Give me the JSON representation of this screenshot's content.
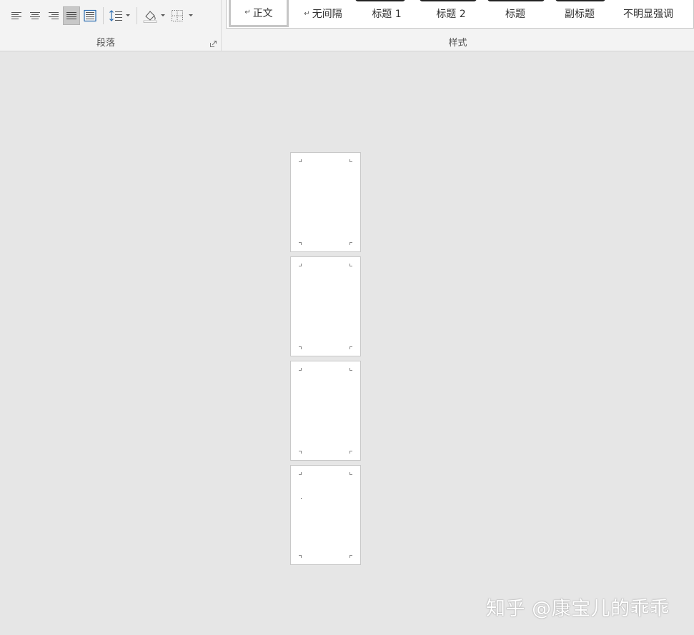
{
  "ribbon": {
    "paragraph_group": {
      "label": "段落",
      "tools": [
        {
          "name": "align-left-icon"
        },
        {
          "name": "align-center-icon"
        },
        {
          "name": "align-right-icon"
        },
        {
          "name": "justify-icon",
          "active": true
        },
        {
          "name": "distributed-icon"
        },
        {
          "name": "line-spacing-icon"
        },
        {
          "name": "shading-icon"
        },
        {
          "name": "borders-icon"
        }
      ]
    },
    "styles_group": {
      "label": "样式",
      "items": [
        {
          "label": "正文",
          "has_para_mark": true,
          "selected": true
        },
        {
          "label": "无间隔",
          "has_para_mark": true,
          "selected": false
        },
        {
          "label": "标题 1",
          "has_para_mark": false,
          "selected": false
        },
        {
          "label": "标题 2",
          "has_para_mark": false,
          "selected": false
        },
        {
          "label": "标题",
          "has_para_mark": false,
          "selected": false
        },
        {
          "label": "副标题",
          "has_para_mark": false,
          "selected": false
        },
        {
          "label": "不明显强调",
          "has_para_mark": false,
          "selected": false
        }
      ],
      "para_mark": "↵"
    }
  },
  "document": {
    "page_count": 4
  },
  "watermark": {
    "text": "知乎 @康宝儿的乖乖"
  }
}
